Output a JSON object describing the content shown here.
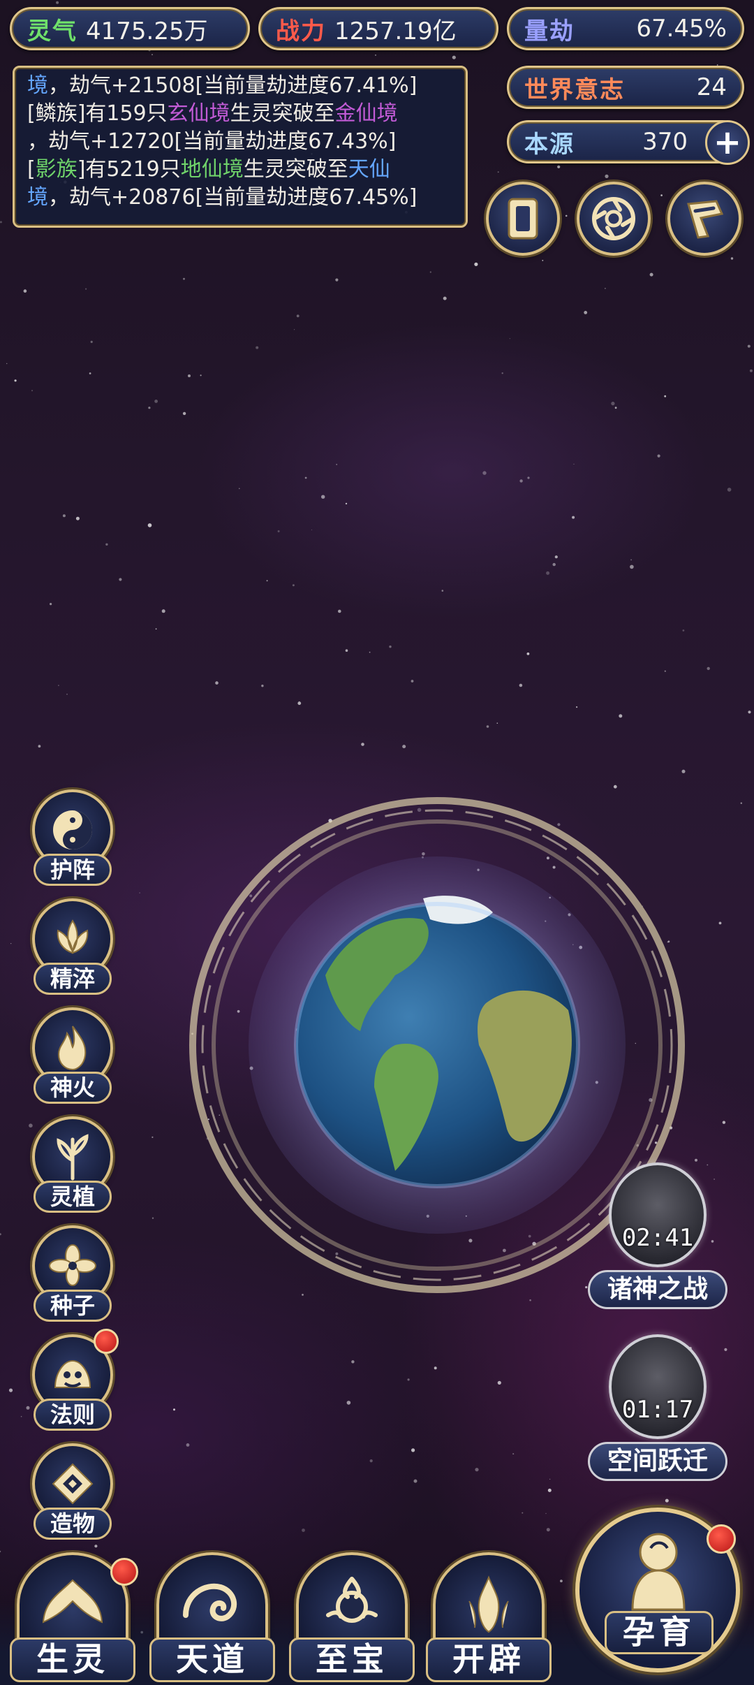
{
  "resources": {
    "lingqi": {
      "label": "灵气",
      "value": "4175.25万",
      "color": "#6fe06a"
    },
    "zhanli": {
      "label": "战力",
      "value": "1257.19亿",
      "color": "#ff5a4a"
    },
    "liangjie": {
      "label": "量劫",
      "value": "67.45%",
      "color": "#9aa0ff"
    },
    "shijie": {
      "label": "世界意志",
      "value": "24",
      "color": "#ff8a5a"
    },
    "benyuan": {
      "label": "本源",
      "value": "370",
      "color": "#a9d8ff"
    }
  },
  "log": {
    "line1_prefix": "境",
    "line1_rest": "，劫气+21508[当前量劫进度67.41%]",
    "line2_a": "[鳞族]有159只",
    "line2_b": "玄仙境",
    "line2_c": "生灵突破至",
    "line2_d": "金仙境",
    "line3": "，劫气+12720[当前量劫进度67.43%]",
    "line4_a": "[",
    "line4_b": "影族",
    "line4_c": "]有5219只",
    "line4_d": "地仙境",
    "line4_e": "生灵突破至",
    "line4_f": "天仙",
    "line5_a": "境",
    "line5_b": "，劫气+20876[当前量劫进度67.45%]"
  },
  "side_menu": [
    "护阵",
    "精淬",
    "神火",
    "灵植",
    "种子",
    "法则",
    "造物"
  ],
  "events": {
    "gods_war": {
      "time": "02:41",
      "label": "诸神之战"
    },
    "space_jump": {
      "time": "01:17",
      "label": "空间跃迁"
    }
  },
  "bottom_nav": [
    "生灵",
    "天道",
    "至宝",
    "开辟"
  ],
  "big_button": "孕育",
  "plus_glyph": "+"
}
